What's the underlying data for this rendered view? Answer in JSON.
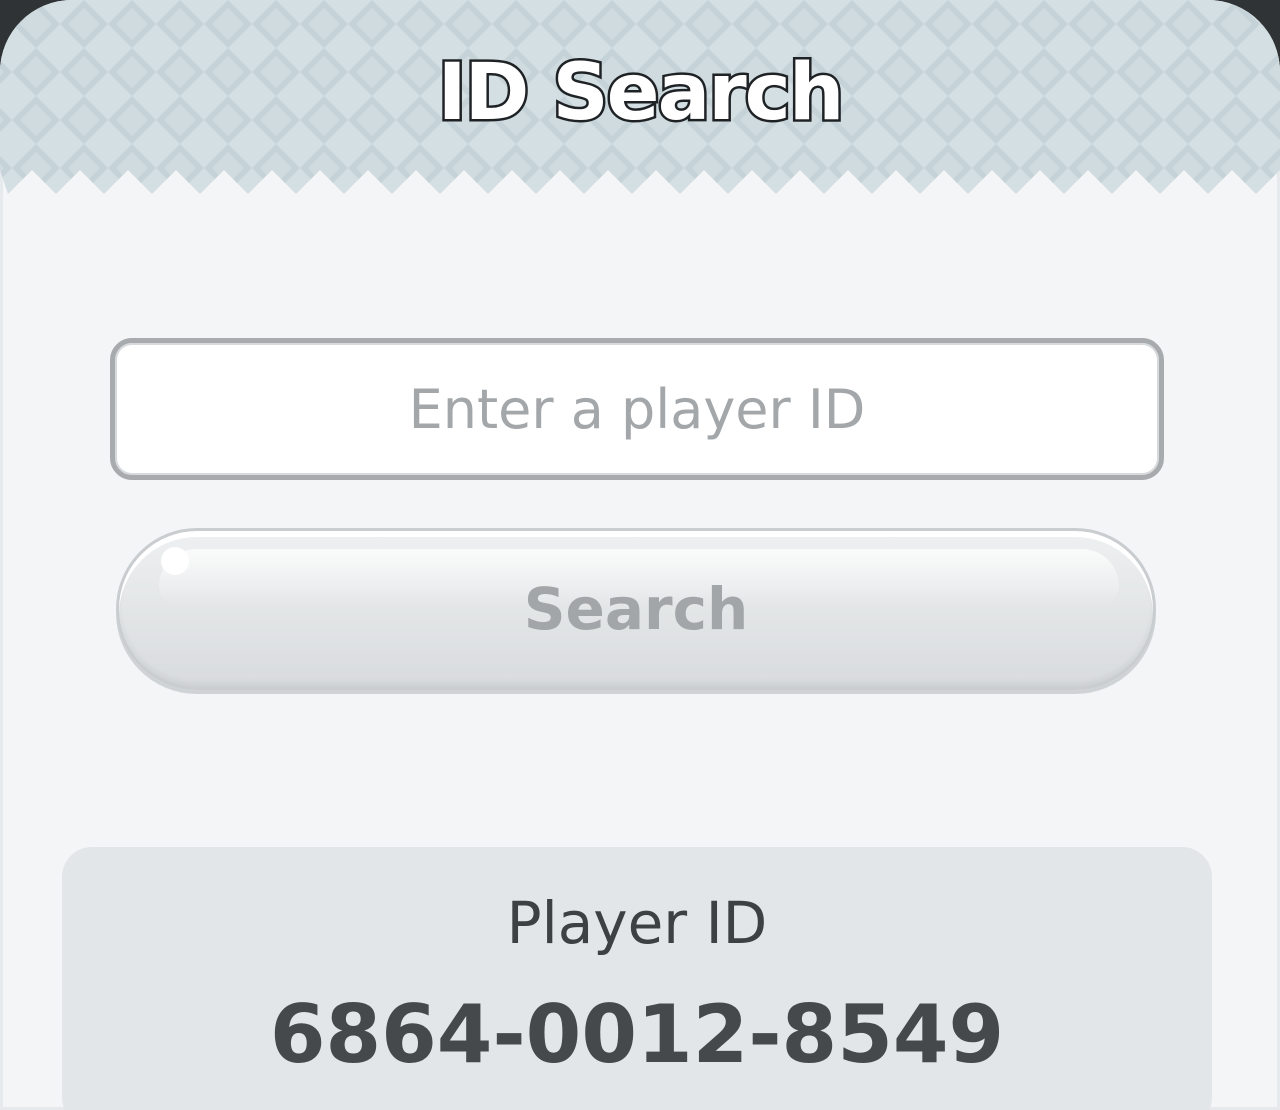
{
  "header": {
    "title": "ID Search"
  },
  "search": {
    "placeholder": "Enter a player ID",
    "value": "",
    "button_label": "Search"
  },
  "player_info": {
    "label": "Player ID",
    "value": "6864-0012-8549"
  },
  "colors": {
    "panel_background": "#f3f5f7",
    "header_pattern_light": "#dde6e9",
    "header_pattern_dark": "#c8d6db",
    "card_background": "#e2e6e9",
    "text_dark": "#46494c",
    "placeholder_text": "#a4a7aa"
  }
}
